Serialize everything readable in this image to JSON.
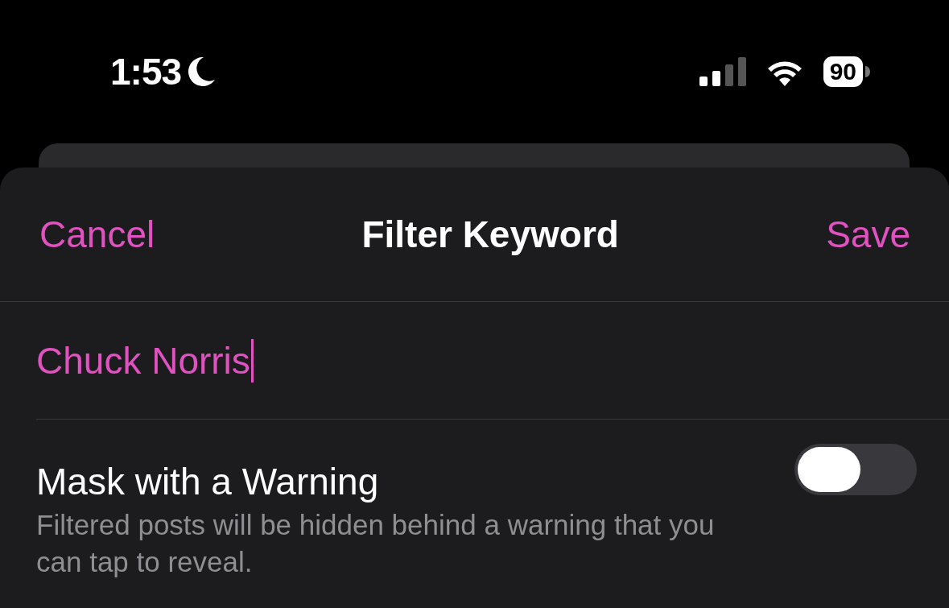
{
  "status_bar": {
    "time": "1:53",
    "battery": "90"
  },
  "nav": {
    "cancel": "Cancel",
    "title": "Filter Keyword",
    "save": "Save"
  },
  "keyword_field": {
    "value": "Chuck Norris"
  },
  "mask_option": {
    "label": "Mask with a Warning",
    "description": "Filtered posts will be hidden behind a warning that you can tap to reveal.",
    "on": false
  }
}
